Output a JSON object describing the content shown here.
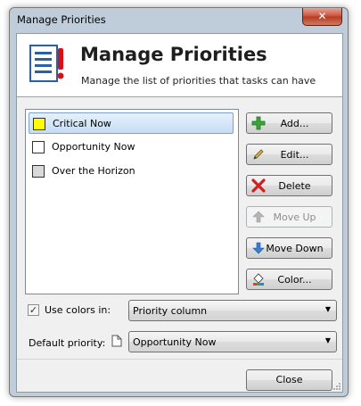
{
  "window": {
    "title": "Manage Priorities",
    "close_glyph": "✕"
  },
  "header": {
    "title": "Manage Priorities",
    "subtitle": "Manage the list of priorities that tasks can have",
    "icon": "list-exclamation-icon"
  },
  "priorities": [
    {
      "label": "Critical Now",
      "color": "#ffff00",
      "selected": true
    },
    {
      "label": "Opportunity Now",
      "color": "#ffffff",
      "selected": false
    },
    {
      "label": "Over the Horizon",
      "color": "#d9d9d9",
      "selected": false
    }
  ],
  "buttons": {
    "add": "Add...",
    "edit": "Edit...",
    "delete": "Delete",
    "move_up": "Move Up",
    "move_down": "Move Down",
    "color": "Color..."
  },
  "use_colors": {
    "label": "Use colors in:",
    "checked": true,
    "check_glyph": "✓",
    "value": "Priority column"
  },
  "default_priority": {
    "label": "Default priority:",
    "value": "Opportunity Now"
  },
  "footer": {
    "close": "Close"
  },
  "colors": {
    "accent": "#2b579a",
    "selection": "#c6ddf5"
  }
}
